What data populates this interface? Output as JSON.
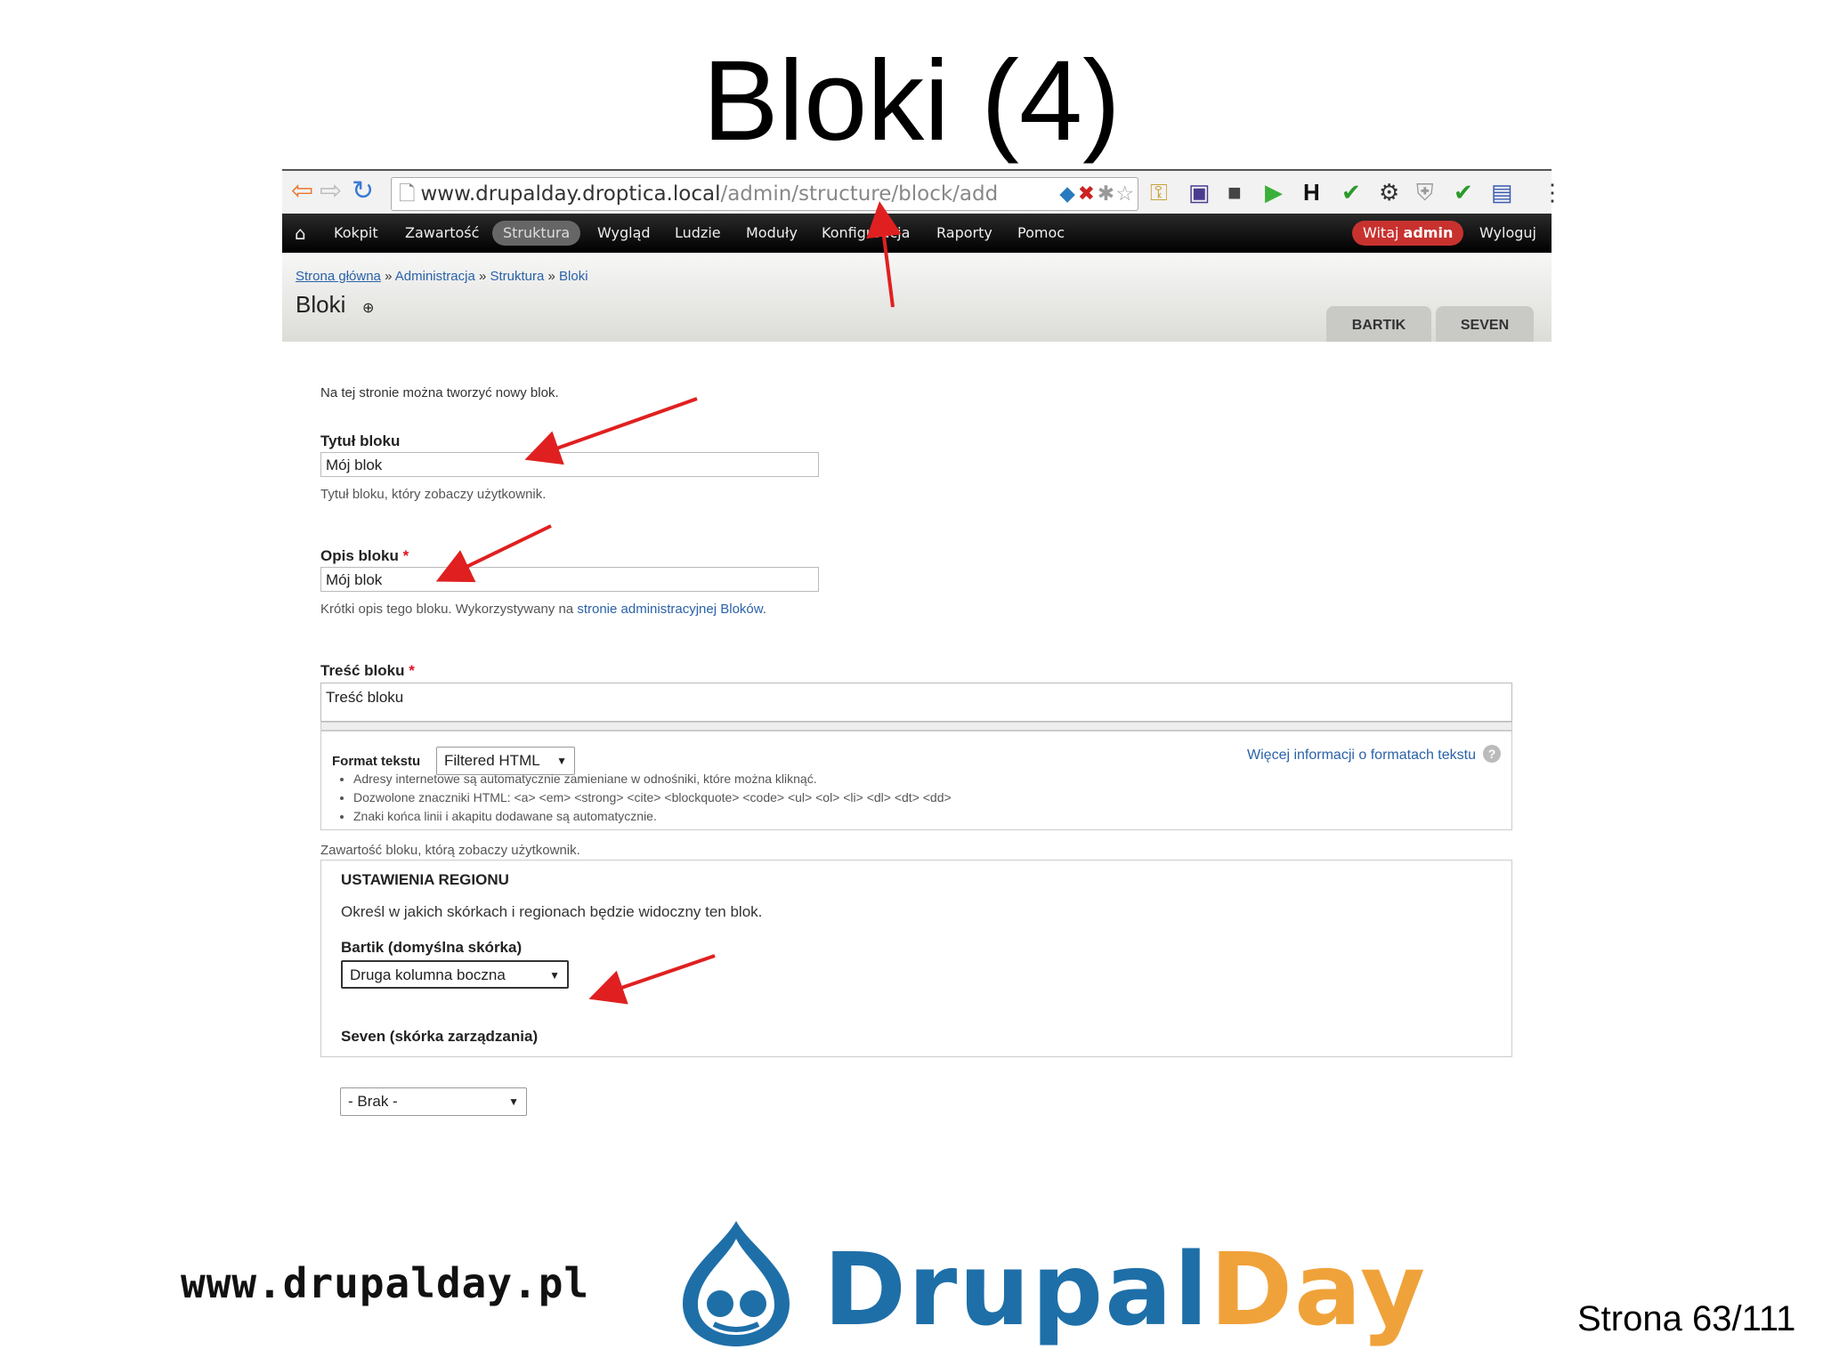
{
  "slide": {
    "title": "Bloki (4)",
    "page_number": "Strona 63/111"
  },
  "browser": {
    "url_host": "www.drupalday.droptica.local",
    "url_path": "/admin/structure/block/add",
    "nav": {
      "back": "back-arrow-icon",
      "forward": "forward-arrow-icon",
      "reload": "reload-icon"
    }
  },
  "toolbar": {
    "home_icon": "home-icon",
    "items": [
      "Kokpit",
      "Zawartość",
      "Struktura",
      "Wygląd",
      "Ludzie",
      "Moduły",
      "Konfiguracja",
      "Raporty",
      "Pomoc"
    ],
    "active": "Struktura",
    "welcome_prefix": "Witaj ",
    "welcome_user": "admin",
    "logout": "Wyloguj",
    "accent": "#c7322f"
  },
  "header": {
    "breadcrumb": [
      "Strona główna",
      "Administracja",
      "Struktura",
      "Bloki"
    ],
    "breadcrumb_separator": "»",
    "title": "Bloki",
    "theme_tabs": [
      "BARTIK",
      "SEVEN"
    ]
  },
  "form": {
    "intro": "Na tej stronie można tworzyć nowy blok.",
    "block_title": {
      "label": "Tytuł bloku",
      "value": "Mój blok",
      "description": "Tytuł bloku, który zobaczy użytkownik."
    },
    "block_description": {
      "label": "Opis bloku",
      "required": "*",
      "value": "Mój blok",
      "description_prefix": "Krótki opis tego bloku. Wykorzystywany na ",
      "description_link": "stronie administracyjnej Bloków",
      "description_suffix": "."
    },
    "block_body": {
      "label": "Treść bloku",
      "required": "*",
      "value": "Treść bloku",
      "description": "Zawartość bloku, którą zobaczy użytkownik."
    },
    "text_format": {
      "label": "Format tekstu",
      "selected": "Filtered HTML",
      "more_info": "Więcej informacji o formatach tekstu",
      "tips": [
        "Adresy internetowe są automatycznie zamieniane w odnośniki, które można kliknąć.",
        "Dozwolone znaczniki HTML: <a> <em> <strong> <cite> <blockquote> <code> <ul> <ol> <li> <dl> <dt> <dd>",
        "Znaki końca linii i akapitu dodawane są automatycznie."
      ]
    },
    "region_settings": {
      "legend": "USTAWIENIA REGIONU",
      "description": "Określ w jakich skórkach i regionach będzie widoczny ten blok.",
      "bartik_label": "Bartik (domyślna skórka)",
      "bartik_selected": "Druga kolumna boczna",
      "seven_label": "Seven (skórka zarządzania)",
      "seven_selected": "- Brak -"
    }
  },
  "footer": {
    "url": "www.drupalday.pl",
    "logo_word1": "Drupal",
    "logo_word2": "Day",
    "logo_color1": "#1e6fa8",
    "logo_color2": "#f0a23a"
  },
  "annotation_color": "#e02020"
}
